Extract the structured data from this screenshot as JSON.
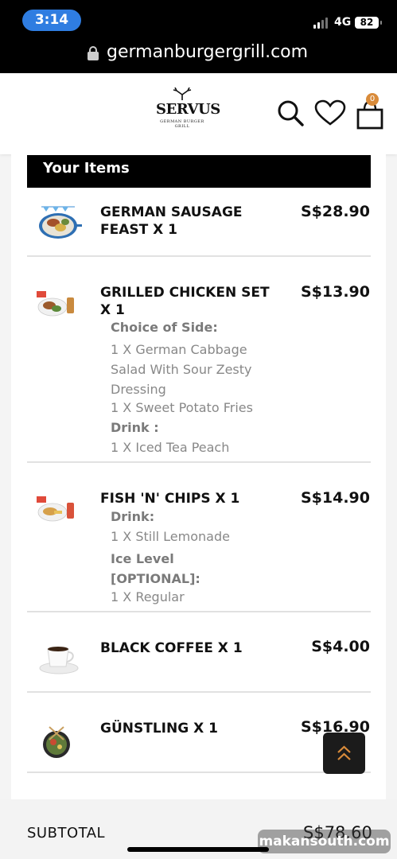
{
  "status_bar": {
    "time": "3:14",
    "network": "4G",
    "battery": "82"
  },
  "browser": {
    "url": "germanburgergrill.com"
  },
  "header": {
    "logo_text": "SERVUS",
    "logo_subtext": "GERMAN BURGER GRILL",
    "cart_count": "0",
    "icons": [
      "search-icon",
      "heart-icon",
      "bag-icon"
    ]
  },
  "order": {
    "section_title": "Your Items",
    "items": [
      {
        "name": "GERMAN SAUSAGE FEAST X 1",
        "price": "S$28.90",
        "thumb": "sausage-platter",
        "options": []
      },
      {
        "name": "GRILLED CHICKEN SET X 1",
        "price": "S$13.90",
        "thumb": "chicken-set",
        "options": [
          {
            "heading": "Choice of Side:",
            "values": [
              "1 X German Cabbage Salad With Sour Zesty Dressing",
              "1 X Sweet Potato Fries"
            ]
          },
          {
            "heading": "Drink :",
            "values": [
              "1 X Iced Tea Peach"
            ]
          }
        ]
      },
      {
        "name": "FISH 'N' CHIPS X 1",
        "price": "S$14.90",
        "thumb": "fish-chips",
        "options": [
          {
            "heading": "Drink:",
            "values": [
              "1 X Still Lemonade"
            ]
          },
          {
            "heading": "Ice Level [OPTIONAL]:",
            "values": [
              "1 X Regular"
            ]
          }
        ]
      },
      {
        "name": "BLACK COFFEE X 1",
        "price": "S$4.00",
        "thumb": "coffee-cup",
        "options": []
      },
      {
        "name": "GÜNSTLING X 1",
        "price": "S$16.90",
        "thumb": "salad-bowl",
        "options": []
      }
    ],
    "subtotal_label": "SUBTOTAL",
    "subtotal_value": "S$78.60"
  },
  "watermark": "makansouth.com",
  "colors": {
    "accent": "#d98b3a",
    "header_bar": "#000000",
    "scroll_button": "#1b1b1b"
  }
}
